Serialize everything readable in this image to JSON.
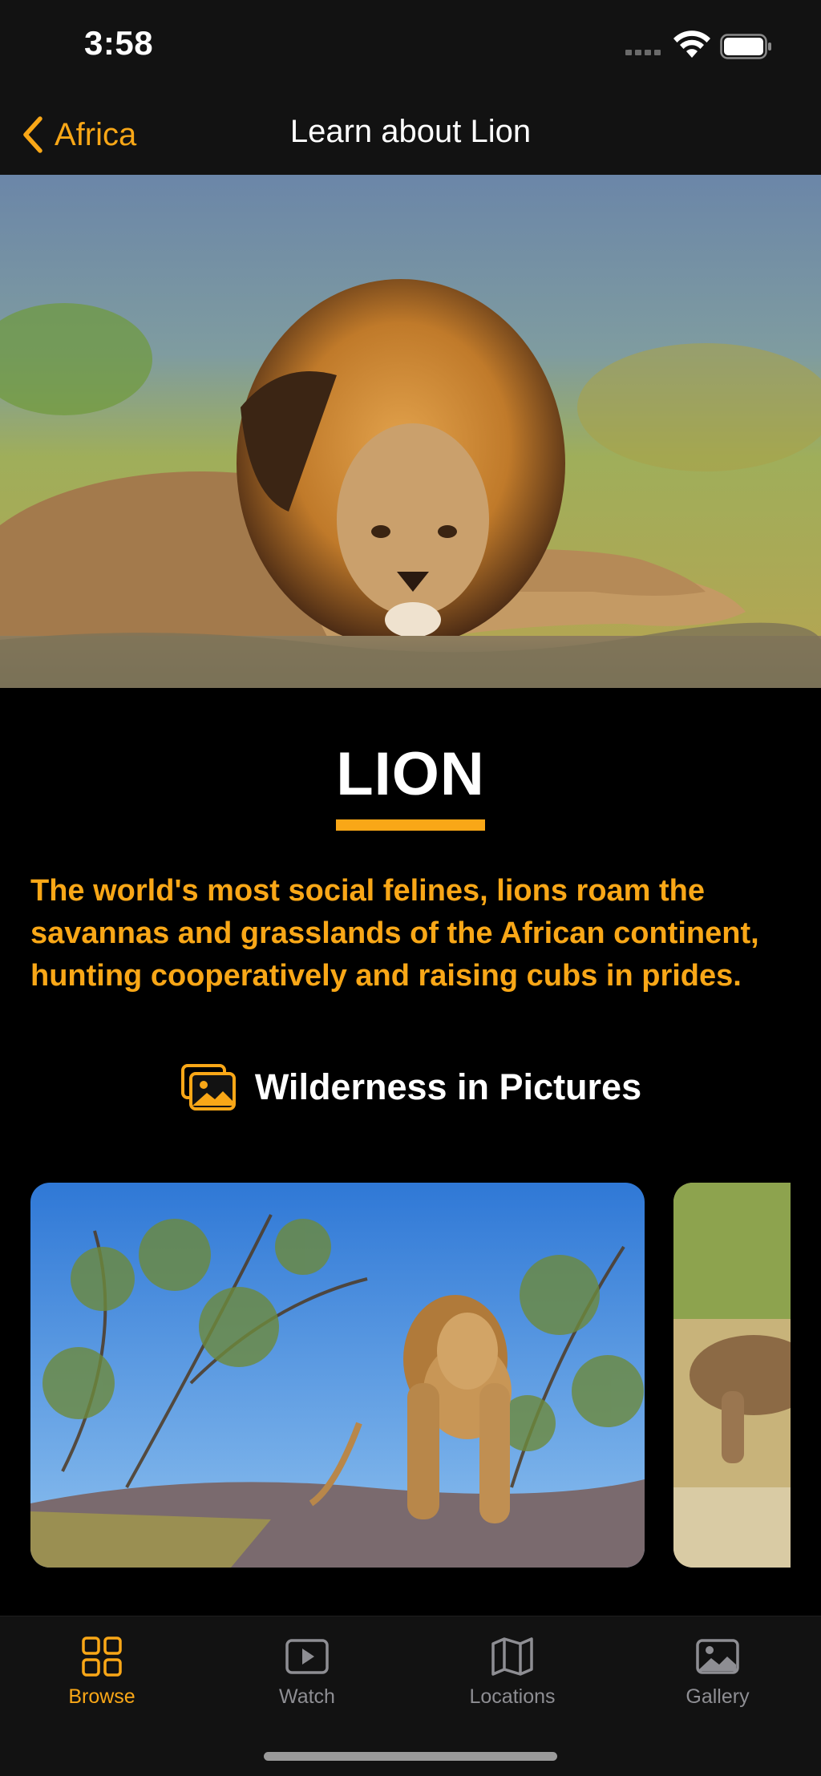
{
  "status_bar": {
    "time": "3:58"
  },
  "nav": {
    "back_label": "Africa",
    "title": "Learn about Lion"
  },
  "animal": {
    "name": "LION",
    "description": "The world's most social felines, lions roam the savannas and grasslands of the African continent, hunting cooperatively and raising cubs in prides."
  },
  "section": {
    "title": "Wilderness in Pictures",
    "icon": "photo-stack-icon"
  },
  "colors": {
    "accent": "#f9a717",
    "bar_background": "#121212",
    "background": "#000000",
    "inactive": "#8e8e93"
  },
  "tabs": [
    {
      "label": "Browse",
      "icon": "grid-icon",
      "active": true
    },
    {
      "label": "Watch",
      "icon": "play-rectangle-icon",
      "active": false
    },
    {
      "label": "Locations",
      "icon": "map-icon",
      "active": false
    },
    {
      "label": "Gallery",
      "icon": "photo-icon",
      "active": false
    }
  ]
}
